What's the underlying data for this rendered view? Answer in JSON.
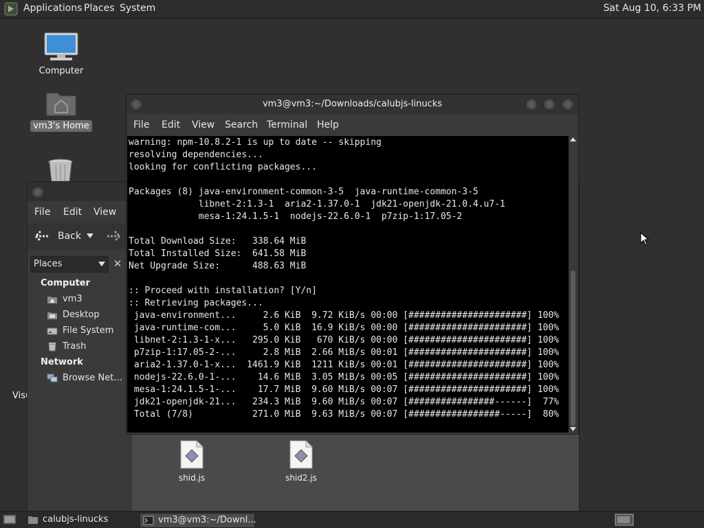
{
  "top_panel": {
    "menus": [
      "Applications",
      "Places",
      "System"
    ],
    "clock": "Sat Aug 10,  6:33 PM"
  },
  "desktop": {
    "icons": [
      {
        "label": "Computer",
        "icon": "computer-icon"
      },
      {
        "label": "vm3's Home",
        "icon": "home-folder-icon"
      },
      {
        "label": "",
        "icon": "trash-icon"
      }
    ],
    "partial_label": "Visu"
  },
  "file_manager": {
    "menus": [
      "File",
      "Edit",
      "View"
    ],
    "toolbar": {
      "back_label": "Back"
    },
    "places_label": "Places",
    "sections": [
      {
        "heading": "Computer",
        "items": [
          "vm3",
          "Desktop",
          "File System",
          "Trash"
        ]
      },
      {
        "heading": "Network",
        "items": [
          "Browse Net…"
        ]
      }
    ],
    "files": [
      "shid.js",
      "shid2.js"
    ]
  },
  "terminal": {
    "title": "vm3@vm3:~/Downloads/calubjs-linucks",
    "menus": [
      "File",
      "Edit",
      "View",
      "Search",
      "Terminal",
      "Help"
    ],
    "lines": [
      "warning: npm-10.8.2-1 is up to date -- skipping",
      "resolving dependencies...",
      "looking for conflicting packages...",
      "",
      "Packages (8) java-environment-common-3-5  java-runtime-common-3-5",
      "             libnet-2:1.3-1  aria2-1.37.0-1  jdk21-openjdk-21.0.4.u7-1",
      "             mesa-1:24.1.5-1  nodejs-22.6.0-1  p7zip-1:17.05-2",
      "",
      "Total Download Size:   338.64 MiB",
      "Total Installed Size:  641.58 MiB",
      "Net Upgrade Size:      488.63 MiB",
      "",
      ":: Proceed with installation? [Y/n]",
      ":: Retrieving packages...",
      " java-environment...     2.6 KiB  9.72 KiB/s 00:00 [######################] 100%",
      " java-runtime-com...     5.0 KiB  16.9 KiB/s 00:00 [######################] 100%",
      " libnet-2:1.3-1-x...   295.0 KiB   670 KiB/s 00:00 [######################] 100%",
      " p7zip-1:17.05-2-...     2.8 MiB  2.66 MiB/s 00:01 [######################] 100%",
      " aria2-1.37.0-1-x...  1461.9 KiB  1211 KiB/s 00:01 [######################] 100%",
      " nodejs-22.6.0-1-...    14.6 MiB  3.05 MiB/s 00:05 [######################] 100%",
      " mesa-1:24.1.5-1-...    17.7 MiB  9.60 MiB/s 00:07 [######################] 100%",
      " jdk21-openjdk-21...   234.3 MiB  9.60 MiB/s 00:07 [################------]  77%",
      " Total (7/8)           271.0 MiB  9.63 MiB/s 00:07 [#################-----]  80%"
    ]
  },
  "taskbar": {
    "tasks": [
      "calubjs-linucks",
      "vm3@vm3:~/Downl..."
    ]
  },
  "colors": {
    "desktop": "#303030",
    "terminal_bg": "#000000",
    "terminal_fg": "#e8e8e8"
  }
}
